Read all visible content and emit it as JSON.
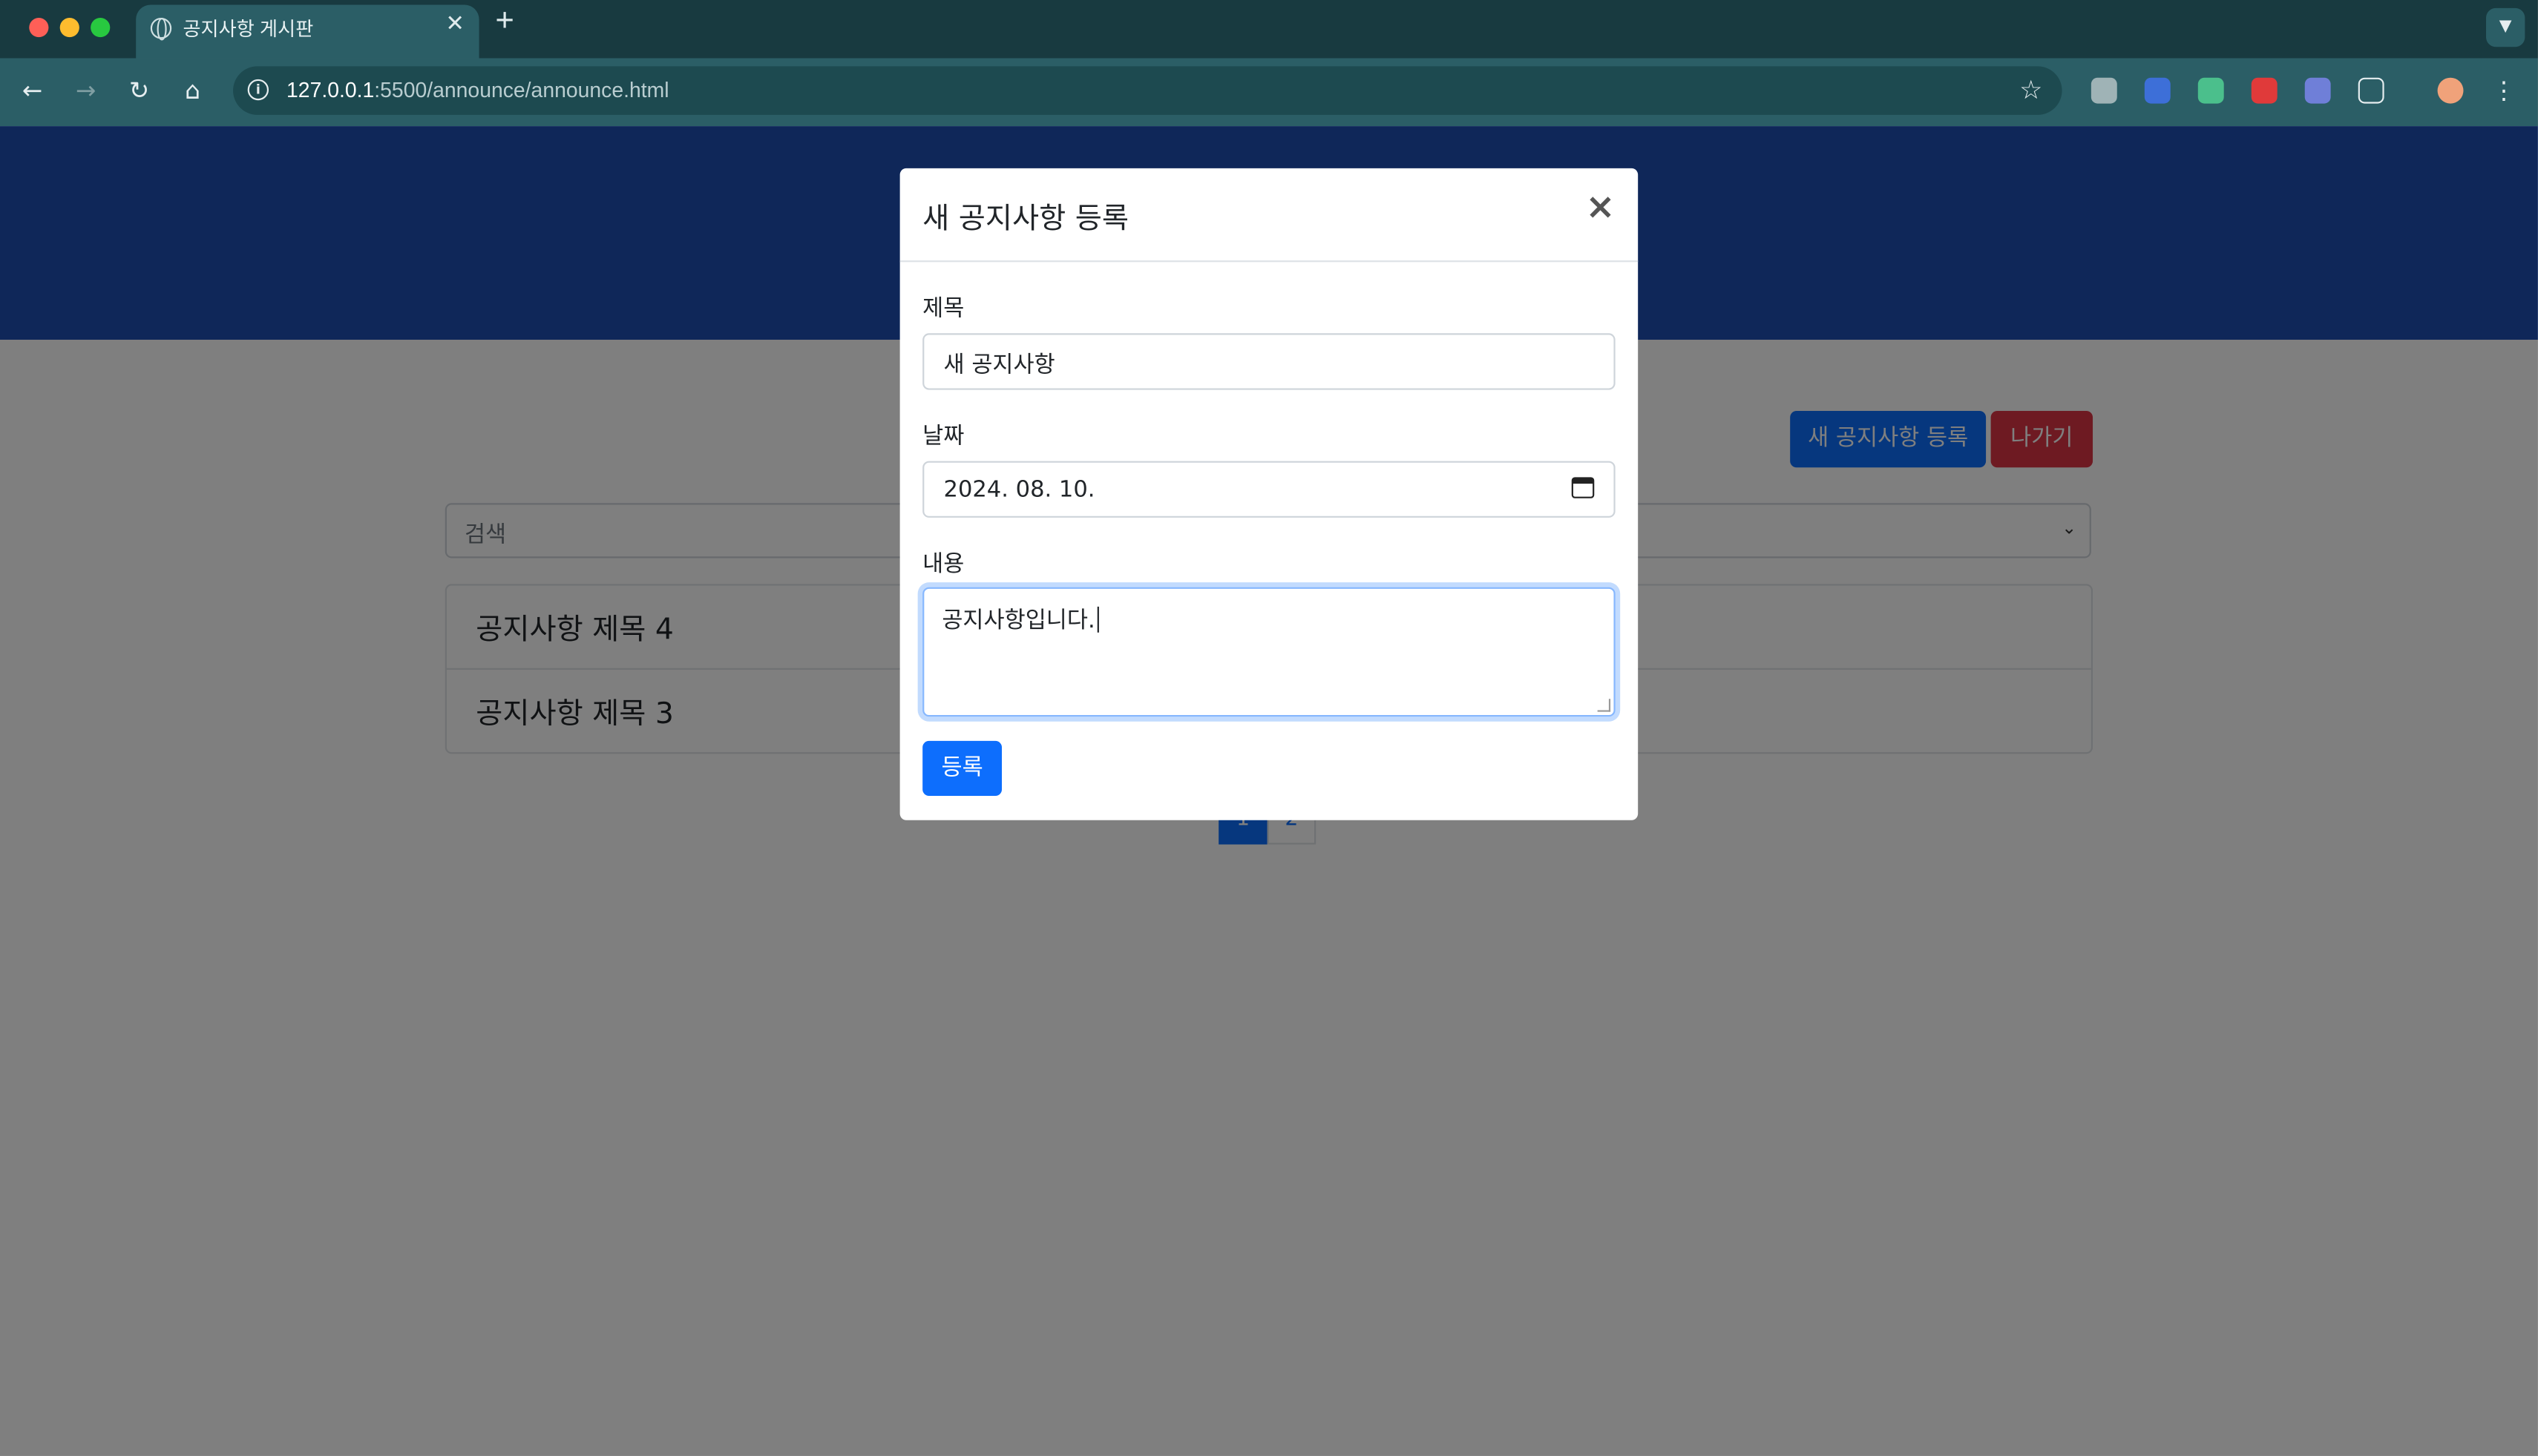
{
  "browser": {
    "tab_title": "공지사항 게시판",
    "url_host": "127.0.0.1",
    "url_rest": ":5500/announce/announce.html"
  },
  "page": {
    "new_button": "새 공지사항 등록",
    "exit_button": "나가기",
    "search_placeholder": "검색",
    "items": [
      {
        "title": "공지사항 제목 4"
      },
      {
        "title": "공지사항 제목 3"
      }
    ],
    "pagination": [
      "1",
      "2"
    ],
    "colors": {
      "hero": "#1f4fb3",
      "primary": "#0d6efd",
      "danger": "#dc3545"
    }
  },
  "modal": {
    "title": "새 공지사항 등록",
    "close": "×",
    "title_label": "제목",
    "title_value": "새 공지사항",
    "date_label": "날짜",
    "date_value": "2024. 08. 10.",
    "content_label": "내용",
    "content_value": "공지사항입니다.",
    "submit": "등록"
  },
  "icons": [
    "globe-icon",
    "close-icon",
    "plus-icon",
    "back-icon",
    "forward-icon",
    "reload-icon",
    "home-icon",
    "info-icon",
    "star-icon",
    "calendar-icon",
    "chevron-down-icon"
  ]
}
